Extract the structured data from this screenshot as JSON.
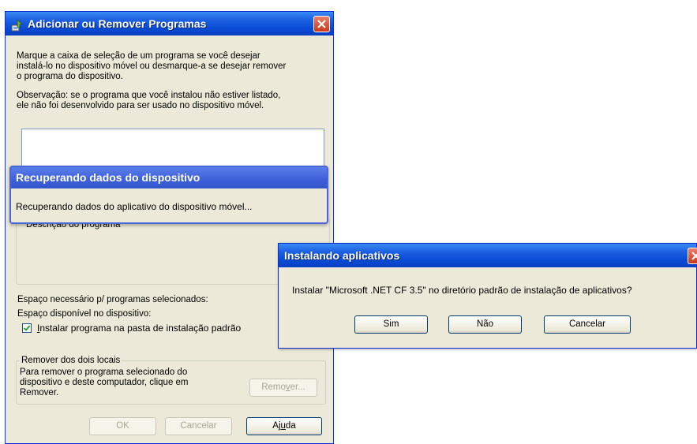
{
  "main_dialog": {
    "title": "Adicionar ou Remover Programas",
    "instruction_line1": "Marque a caixa de seleção de um programa se você desejar",
    "instruction_line2": "instalá-lo no dispositivo móvel ou desmarque-a se desejar remover",
    "instruction_line3": "o programa do dispositivo.",
    "note_line1": "Observação: se o programa que você instalou não estiver listado,",
    "note_line2": "ele não foi desenvolvido para ser usado no dispositivo móvel.",
    "program_description_label": "Descrição do programa",
    "space_required_label": "Espaço necessário p/ programas selecionados:",
    "space_available_label": "Espaço disponível no dispositivo:",
    "install_default_checkbox": {
      "checked": true,
      "accel": "I",
      "rest": "nstalar programa na pasta de instalação padrão"
    },
    "remove_group": {
      "title": "Remover dos dois locais",
      "line1": "Para remover o programa selecionado do",
      "line2": "dispositivo e deste computador, clique em",
      "line3": "Remover.",
      "remove_button": {
        "pre": "Remo",
        "accel": "v",
        "post": "er..."
      }
    },
    "ok_button": "OK",
    "cancel_button": "Cancelar",
    "help_button": {
      "pre": "Aj",
      "accel": "u",
      "post": "da"
    }
  },
  "progress_dialog": {
    "title": "Recuperando dados do dispositivo",
    "message": "Recuperando dados do aplicativo do dispositivo móvel..."
  },
  "install_dialog": {
    "title": "Instalando aplicativos",
    "message": "Instalar \"Microsoft .NET CF 3.5\" no diretório padrão de instalação de aplicativos?",
    "yes_button": "Sim",
    "no_button": "Não",
    "cancel_button": "Cancelar"
  },
  "icons": {
    "app": "add-remove-programs-icon",
    "close": "close-icon",
    "check": "checkmark-icon"
  },
  "colors": {
    "titlebar": "#0a4bd4",
    "close": "#c9381a",
    "dialog_bg": "#ece9d8"
  }
}
